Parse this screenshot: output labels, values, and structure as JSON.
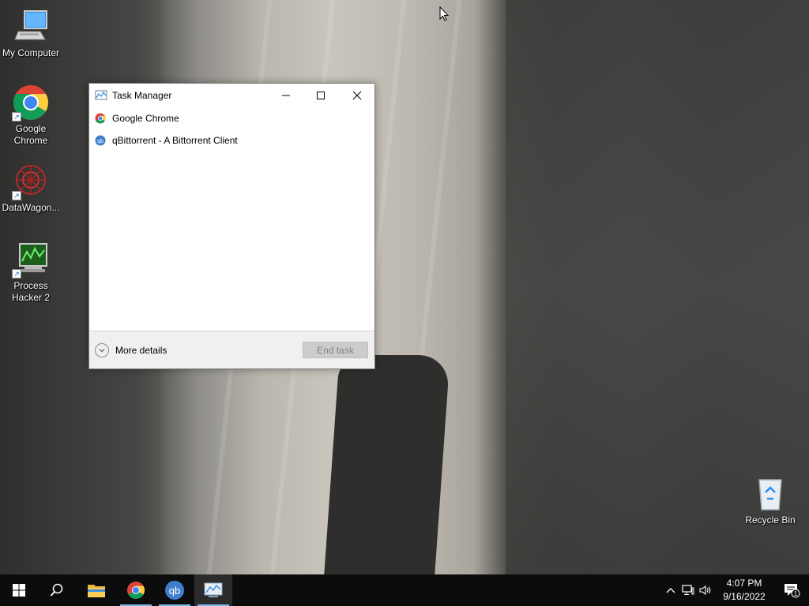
{
  "desktop": {
    "icons": [
      {
        "label": "My Computer"
      },
      {
        "label": "Google Chrome"
      },
      {
        "label": "DataWagon..."
      },
      {
        "label": "Process Hacker 2"
      },
      {
        "label": "Recycle Bin"
      }
    ]
  },
  "task_manager": {
    "title": "Task Manager",
    "apps": [
      {
        "name": "Google Chrome",
        "icon": "chrome-icon"
      },
      {
        "name": "qBittorrent - A Bittorrent Client",
        "icon": "qbittorrent-icon"
      }
    ],
    "more_details_label": "More details",
    "end_task_label": "End task"
  },
  "taskbar": {
    "pinned": [
      "start-icon",
      "search-icon",
      "file-explorer-icon",
      "chrome-icon",
      "qbittorrent-icon",
      "task-manager-icon"
    ],
    "tray": {
      "time": "4:07 PM",
      "date": "9/16/2022",
      "notification_count": "1"
    }
  }
}
